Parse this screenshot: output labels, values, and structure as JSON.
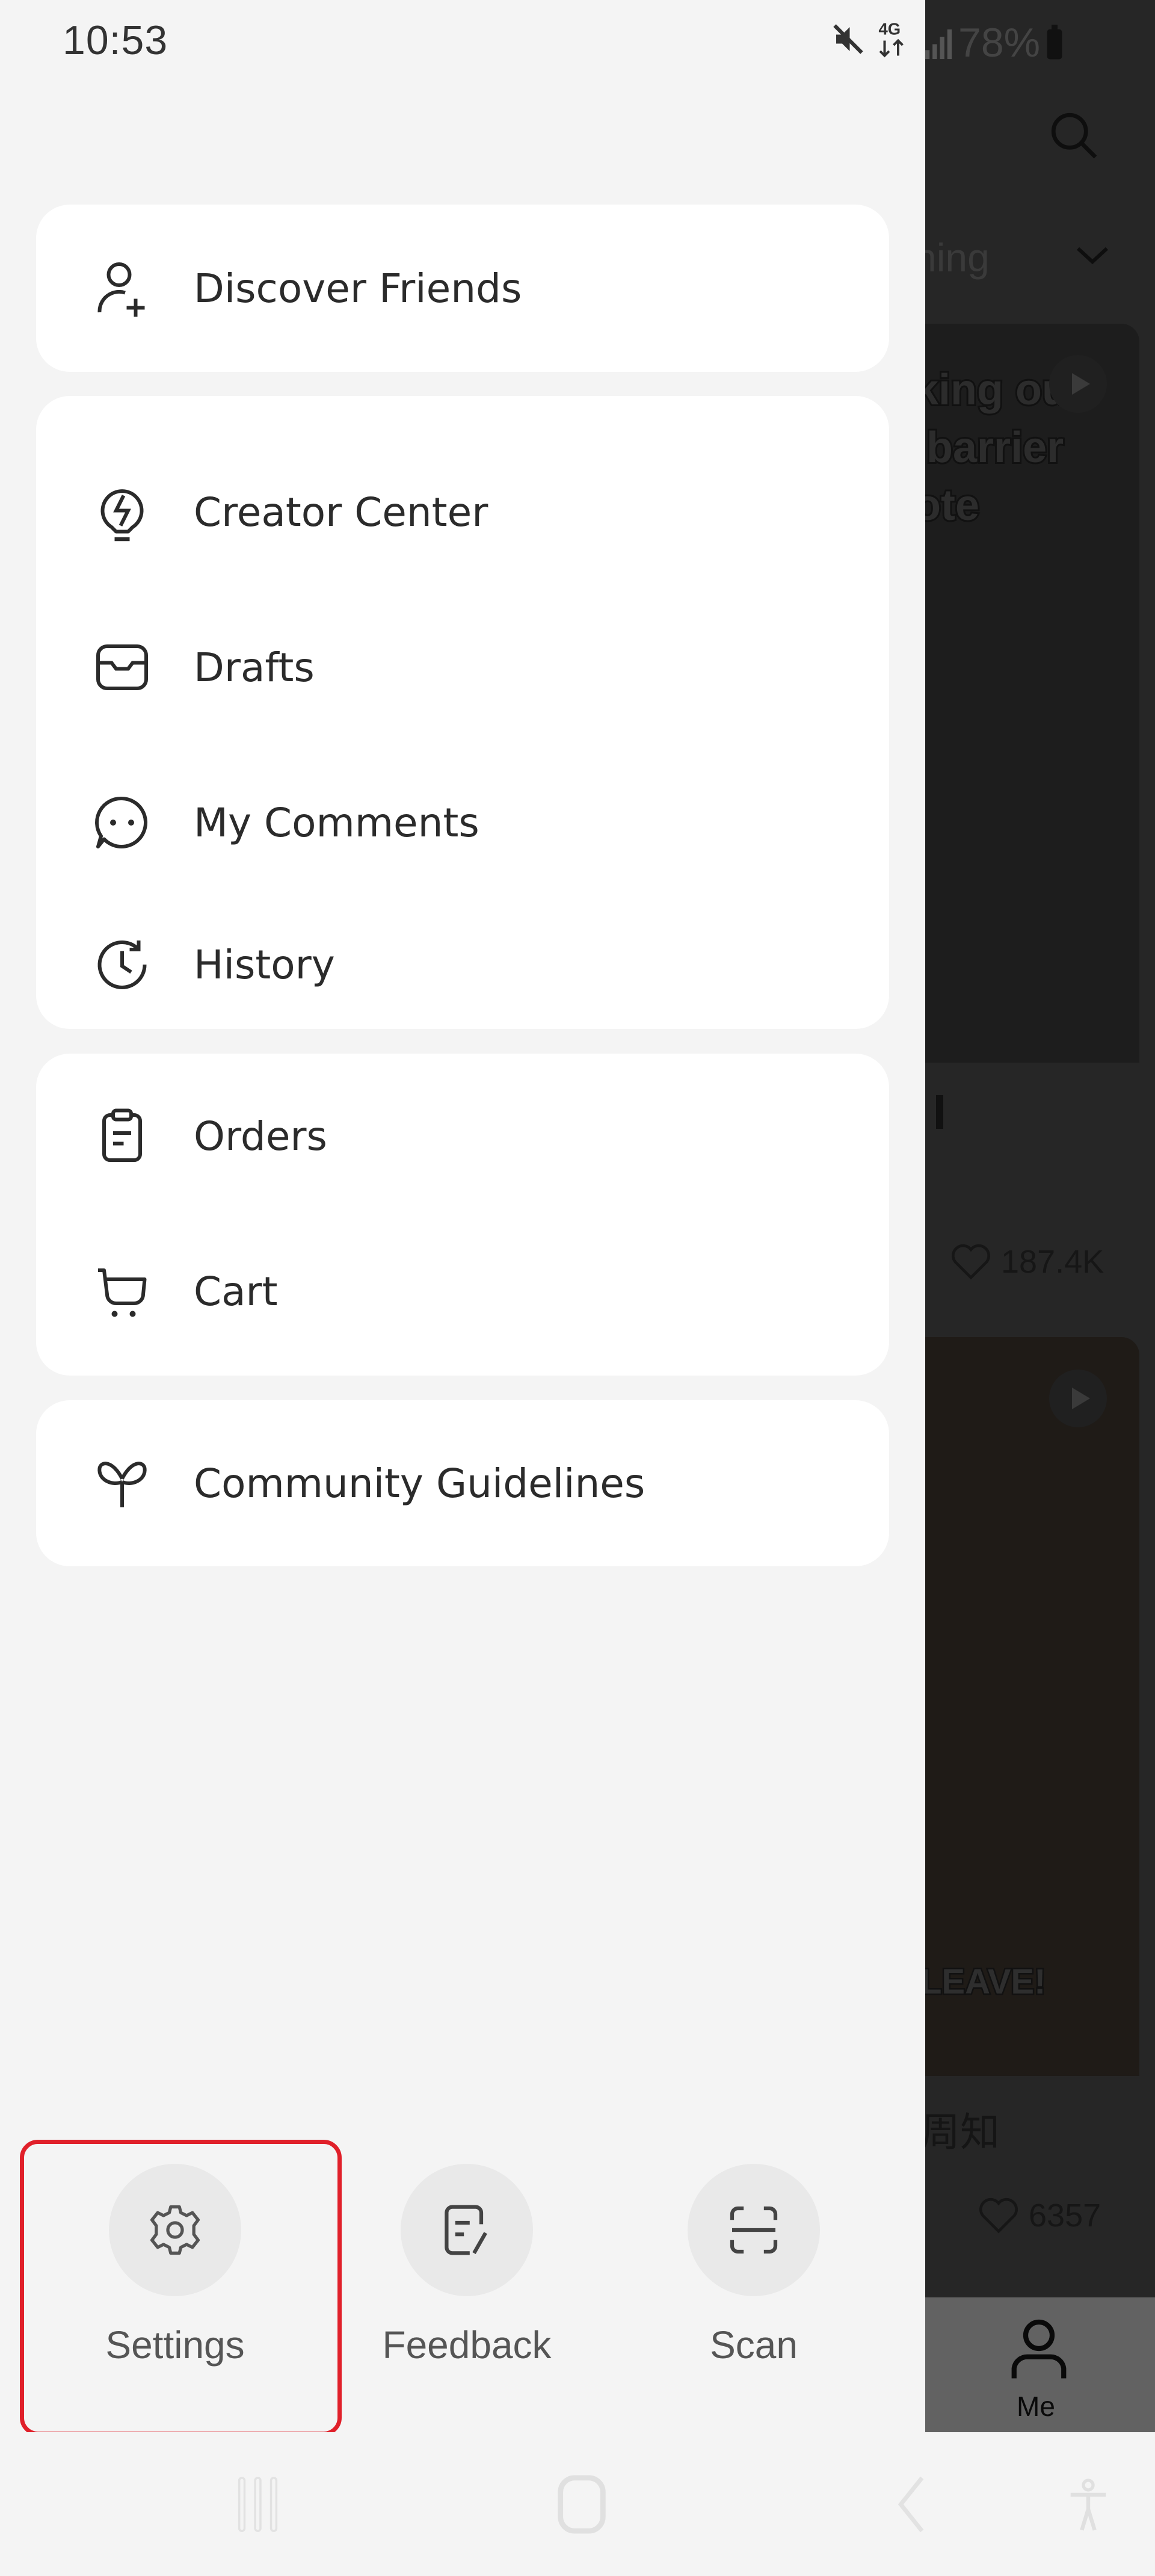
{
  "status_bar": {
    "time": "10:53",
    "icons": [
      "mute-icon",
      "4g-data-icon",
      "signal-icon"
    ],
    "battery": "78%"
  },
  "drawer": {
    "groups": [
      {
        "items": [
          {
            "label": "Discover Friends",
            "icon": "add-friend-icon"
          }
        ]
      },
      {
        "items": [
          {
            "label": "Creator Center",
            "icon": "lightbulb-bolt-icon"
          },
          {
            "label": "Drafts",
            "icon": "inbox-tray-icon"
          },
          {
            "label": "My Comments",
            "icon": "chat-bubble-icon"
          },
          {
            "label": "History",
            "icon": "history-clock-icon"
          }
        ]
      },
      {
        "items": [
          {
            "label": "Orders",
            "icon": "clipboard-icon"
          },
          {
            "label": "Cart",
            "icon": "cart-icon"
          }
        ]
      },
      {
        "items": [
          {
            "label": "Community Guidelines",
            "icon": "sprout-icon"
          }
        ]
      }
    ],
    "bottom_actions": [
      {
        "label": "Settings",
        "icon": "gear-icon",
        "highlighted": true
      },
      {
        "label": "Feedback",
        "icon": "feedback-edit-icon"
      },
      {
        "label": "Scan",
        "icon": "scan-icon"
      }
    ],
    "highlight_color": "#e0202a"
  },
  "background_app": {
    "tab_partial": "ning",
    "post1_overlay_text": "king out\n barrier\note",
    "post1_caption": "I",
    "post1_likes": "187.4K",
    "post2_overlay_text": "LEAVE!",
    "post2_caption": "周知",
    "post2_likes": "6357",
    "tab_me": "Me"
  },
  "system_nav": [
    "recents-icon",
    "home-icon",
    "back-icon",
    "accessibility-icon"
  ]
}
